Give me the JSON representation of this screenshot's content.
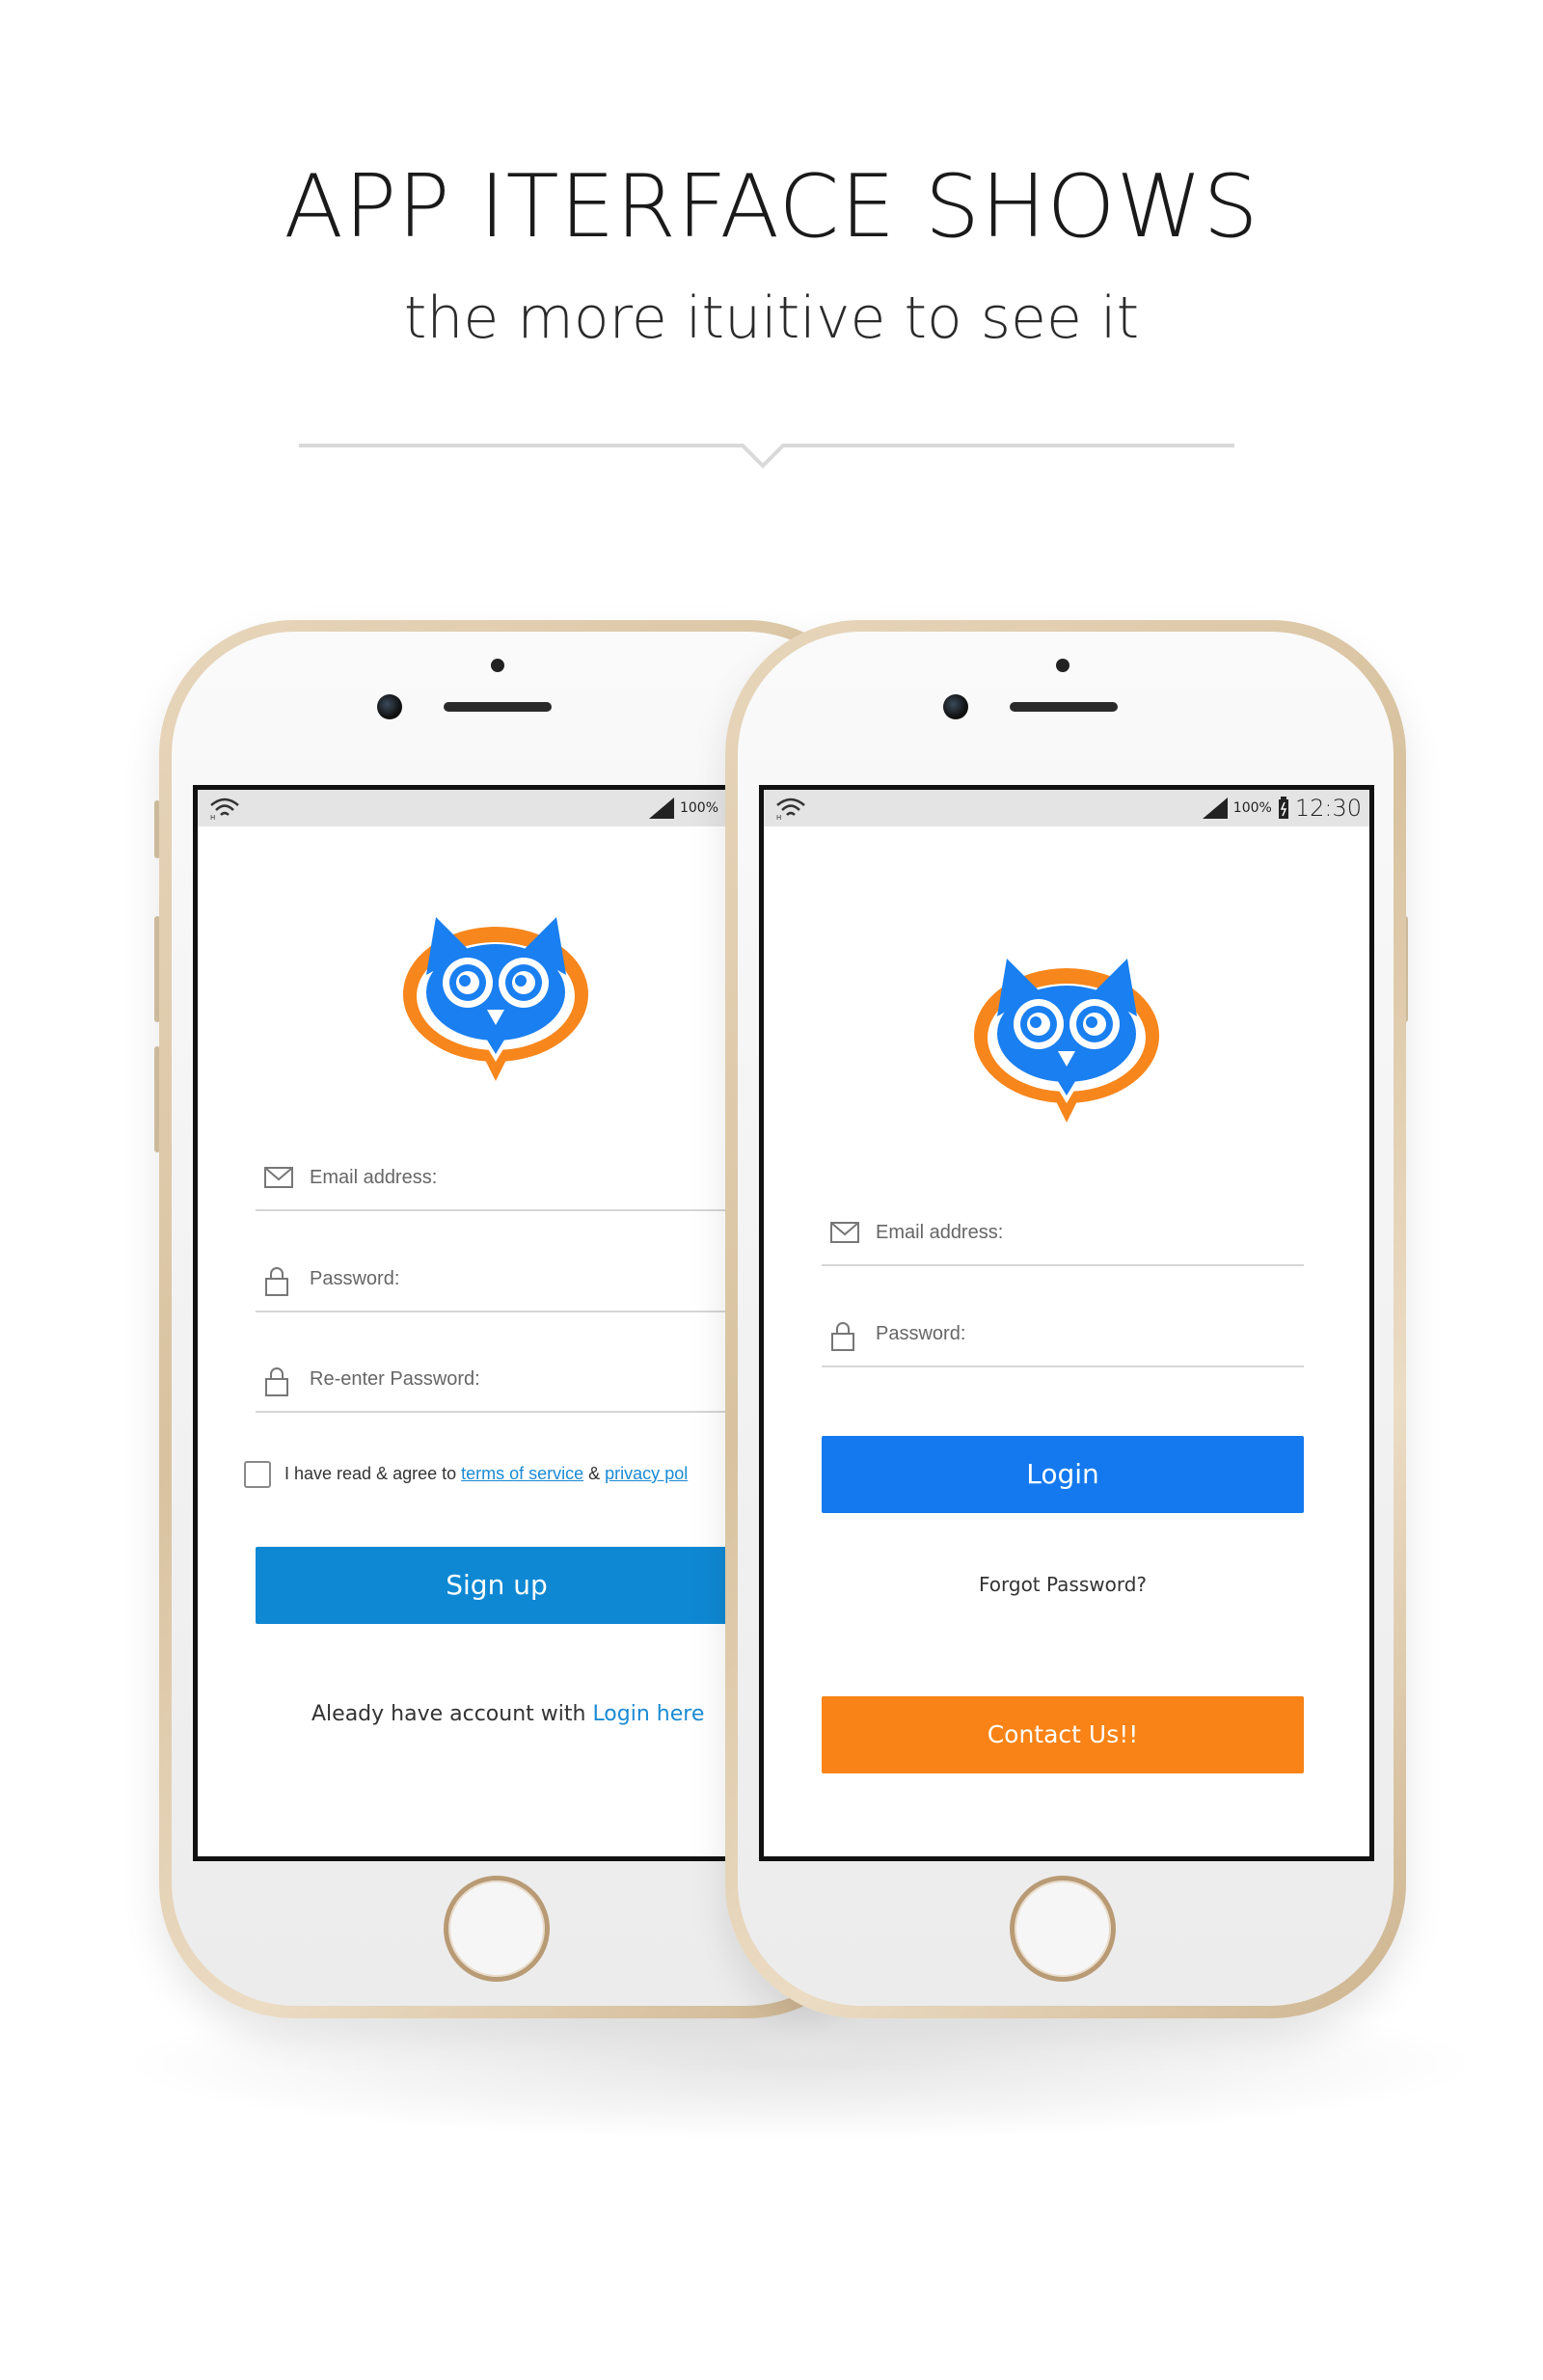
{
  "heading": {
    "title": "APP ITERFACE SHOWS",
    "subtitle": "the more ituitive to see it"
  },
  "colors": {
    "owl_blue": "#1a7ff0",
    "owl_orange": "#f7861c",
    "signup_blue": "#0f88d3",
    "login_blue": "#1479ee",
    "contact_orange": "#f98316"
  },
  "signup_screen": {
    "status": {
      "battery": "100%"
    },
    "email_placeholder": "Email address:",
    "password_placeholder": "Password:",
    "reenter_placeholder": "Re-enter Password:",
    "agree_text": "I have read & agree to ",
    "terms_link": "terms of service",
    "amp": " & ",
    "privacy_link": "privacy pol",
    "signup_button": "Sign up",
    "already_text": "Aleady have account with ",
    "login_here_link": "Login here"
  },
  "login_screen": {
    "status": {
      "battery": "100%",
      "time": "12:30"
    },
    "email_placeholder": "Email address:",
    "password_placeholder": "Password:",
    "login_button": "Login",
    "forgot_link": "Forgot Password?",
    "contact_button": "Contact Us!!"
  }
}
